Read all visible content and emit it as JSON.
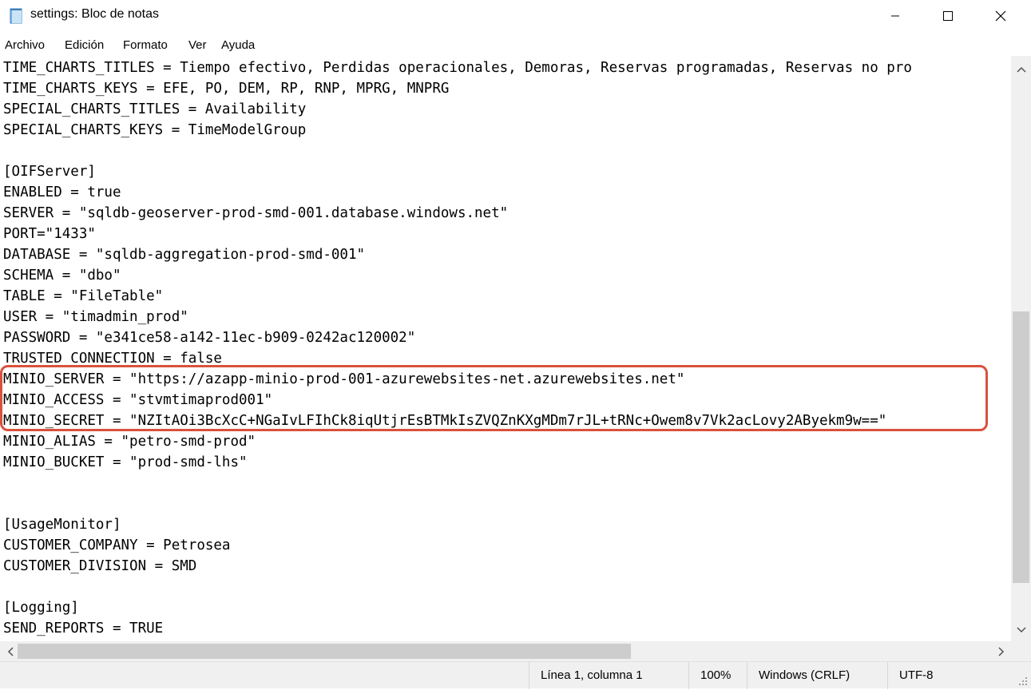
{
  "window": {
    "title": "settings: Bloc de notas"
  },
  "menu": {
    "items": [
      "Archivo",
      "Edición",
      "Formato",
      "Ver",
      "Ayuda"
    ]
  },
  "editor": {
    "lines": [
      "TIME_CHARTS_TITLES = Tiempo efectivo, Perdidas operacionales, Demoras, Reservas programadas, Reservas no pro",
      "TIME_CHARTS_KEYS = EFE, PO, DEM, RP, RNP, MPRG, MNPRG",
      "SPECIAL_CHARTS_TITLES = Availability",
      "SPECIAL_CHARTS_KEYS = TimeModelGroup",
      "",
      "[OIFServer]",
      "ENABLED = true",
      "SERVER = \"sqldb-geoserver-prod-smd-001.database.windows.net\"",
      "PORT=\"1433\"",
      "DATABASE = \"sqldb-aggregation-prod-smd-001\"",
      "SCHEMA = \"dbo\"",
      "TABLE = \"FileTable\"",
      "USER = \"timadmin_prod\"",
      "PASSWORD = \"e341ce58-a142-11ec-b909-0242ac120002\"",
      "TRUSTED_CONNECTION = false",
      "MINIO_SERVER = \"https://azapp-minio-prod-001-azurewebsites-net.azurewebsites.net\"",
      "MINIO_ACCESS = \"stvmtimaprod001\"",
      "MINIO_SECRET = \"NZItAOi3BcXcC+NGaIvLFIhCk8iqUtjrEsBTMkIsZVQZnKXgMDm7rJL+tRNc+Owem8v7Vk2acLovy2AByekm9w==\"",
      "MINIO_ALIAS = \"petro-smd-prod\"",
      "MINIO_BUCKET = \"prod-smd-lhs\"",
      "",
      "",
      "[UsageMonitor]",
      "CUSTOMER_COMPANY = Petrosea",
      "CUSTOMER_DIVISION = SMD",
      "",
      "[Logging]",
      "SEND_REPORTS = TRUE"
    ]
  },
  "status": {
    "position": "Línea 1, columna 1",
    "zoom": "100%",
    "line_ending": "Windows (CRLF)",
    "encoding": "UTF-8"
  },
  "colors": {
    "highlight_border": "#d9513c"
  }
}
